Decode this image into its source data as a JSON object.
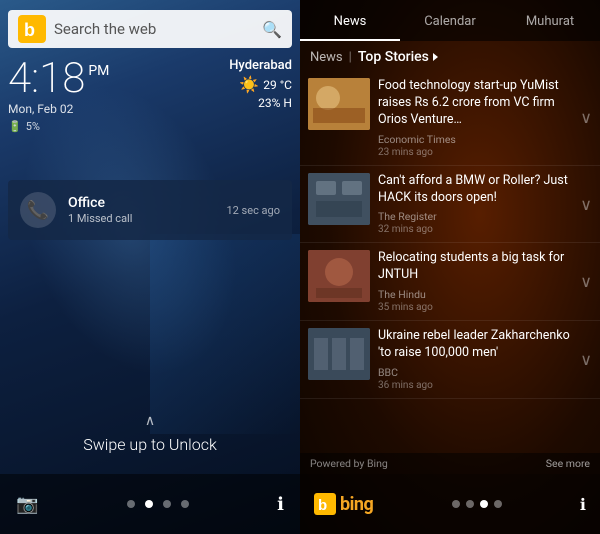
{
  "left": {
    "search_placeholder": "Search the web",
    "time": "4:18",
    "ampm": "PM",
    "date": "Mon, Feb 02",
    "battery": "5%",
    "city": "Hyderabad",
    "temp": "29 °C",
    "humidity": "23% H",
    "notification": {
      "title": "Office",
      "subtitle": "1 Missed call",
      "time": "12 sec ago"
    },
    "swipe_text": "Swipe up to Unlock"
  },
  "right": {
    "tabs": [
      "News",
      "Calendar",
      "Muhurat"
    ],
    "active_tab": "News",
    "section_label": "News",
    "section_title": "Top Stories",
    "stories": [
      {
        "title": "Food technology start-up YuMist raises Rs 6.2 crore from VC firm Orios Venture…",
        "source": "Economic Times",
        "time": "23 mins ago"
      },
      {
        "title": "Can't afford a BMW or Roller? Just HACK its doors open!",
        "source": "The Register",
        "time": "32 mins ago"
      },
      {
        "title": "Relocating students a big task for JNTUH",
        "source": "The Hindu",
        "time": "35 mins ago"
      },
      {
        "title": "Ukraine rebel leader Zakharchenko 'to raise 100,000 men'",
        "source": "BBC",
        "time": "36 mins ago"
      }
    ],
    "footer_powered": "Powered by Bing",
    "footer_see_more": "See more",
    "bing_label": "bing"
  }
}
